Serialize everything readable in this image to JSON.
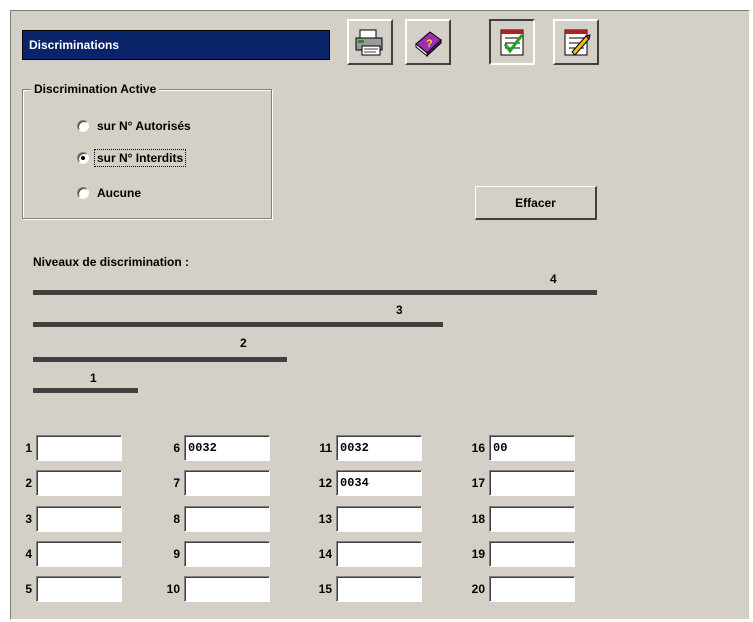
{
  "title": "Discriminations",
  "toolbar": {
    "buttons": [
      {
        "name": "print-button",
        "icon": "printer-icon"
      },
      {
        "name": "help-button",
        "icon": "help-book-icon"
      },
      {
        "name": "validate-button",
        "icon": "checklist-check-icon"
      },
      {
        "name": "edit-button",
        "icon": "checklist-edit-icon"
      }
    ]
  },
  "discrimination": {
    "legend": "Discrimination Active",
    "options": [
      {
        "label": "sur N° Autorisés",
        "checked": false
      },
      {
        "label": "sur N° Interdits",
        "checked": true
      },
      {
        "label": "Aucune",
        "checked": false
      }
    ]
  },
  "effacer_label": "Effacer",
  "niveaux": {
    "label": "Niveaux de discrimination :",
    "levels": [
      "4",
      "3",
      "2",
      "1"
    ]
  },
  "fields": [
    {
      "num": "1",
      "value": ""
    },
    {
      "num": "2",
      "value": ""
    },
    {
      "num": "3",
      "value": ""
    },
    {
      "num": "4",
      "value": ""
    },
    {
      "num": "5",
      "value": ""
    },
    {
      "num": "6",
      "value": "0032"
    },
    {
      "num": "7",
      "value": ""
    },
    {
      "num": "8",
      "value": ""
    },
    {
      "num": "9",
      "value": ""
    },
    {
      "num": "10",
      "value": ""
    },
    {
      "num": "11",
      "value": "0032"
    },
    {
      "num": "12",
      "value": "0034"
    },
    {
      "num": "13",
      "value": ""
    },
    {
      "num": "14",
      "value": ""
    },
    {
      "num": "15",
      "value": ""
    },
    {
      "num": "16",
      "value": "00"
    },
    {
      "num": "17",
      "value": ""
    },
    {
      "num": "18",
      "value": ""
    },
    {
      "num": "19",
      "value": ""
    },
    {
      "num": "20",
      "value": ""
    }
  ],
  "colors": {
    "title_bg": "#0a246a",
    "panel_bg": "#d4d0c8",
    "bar": "#404040"
  }
}
